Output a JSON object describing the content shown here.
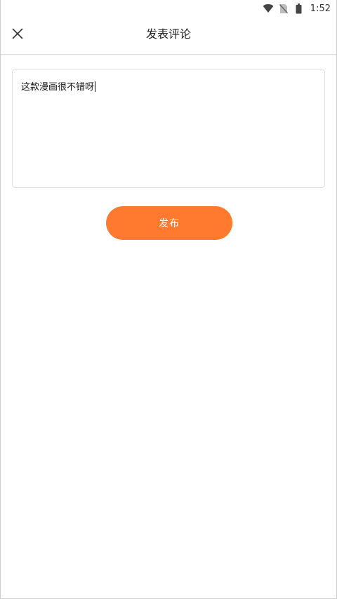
{
  "status_bar": {
    "time": "1:52",
    "icons": [
      "wifi-icon",
      "no-sim-icon",
      "battery-icon"
    ]
  },
  "header": {
    "title": "发表评论",
    "close_icon": "close-icon"
  },
  "comment": {
    "value": "这款漫画很不错呀"
  },
  "publish": {
    "label": "发布"
  },
  "colors": {
    "accent": "#ff7a2f",
    "divider": "#dcdcdc",
    "text": "#222222",
    "background": "#ffffff"
  }
}
